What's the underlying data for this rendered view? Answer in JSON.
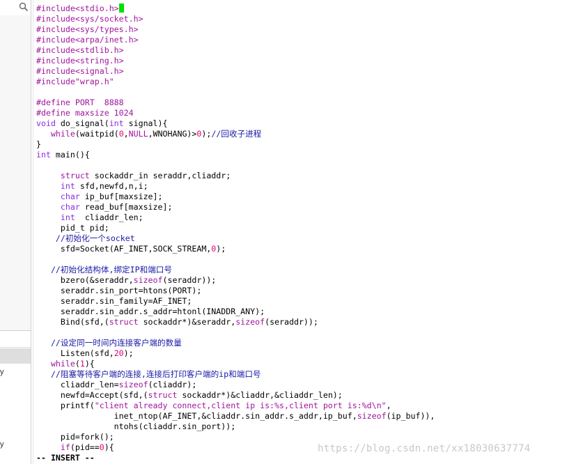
{
  "lower_panel": {
    "item_1_text": "y",
    "item_2_text": "y"
  },
  "code_lines": [
    "#include<stdio.h>",
    "#include<sys/socket.h>",
    "#include<sys/types.h>",
    "#include<arpa/inet.h>",
    "#include<stdlib.h>",
    "#include<string.h>",
    "#include<signal.h>",
    "#include\"wrap.h\"",
    "",
    "#define PORT  8888",
    "#define maxsize 1024",
    "void do_signal(int signal){",
    "   while(waitpid(0,NULL,WNOHANG)>0);//回收子进程",
    "}",
    "int main(){",
    "",
    "     struct sockaddr_in seraddr,cliaddr;",
    "     int sfd,newfd,n,i;",
    "     char ip_buf[maxsize];",
    "     char read_buf[maxsize];",
    "     int  cliaddr_len;",
    "     pid_t pid;",
    "    //初始化一个socket",
    "     sfd=Socket(AF_INET,SOCK_STREAM,0);",
    "",
    "   //初始化结构体,绑定IP和端口号",
    "     bzero(&seraddr,sizeof(seraddr));",
    "     seraddr.sin_port=htons(PORT);",
    "     seraddr.sin_family=AF_INET;",
    "     seraddr.sin_addr.s_addr=htonl(INADDR_ANY);",
    "     Bind(sfd,(struct sockaddr*)&seraddr,sizeof(seraddr));",
    "",
    "   //设定同一时间内连接客户端的数量",
    "     Listen(sfd,20);",
    "   while(1){",
    "   //阻塞等待客户端的连接,连接后打印客户端的ip和端口号",
    "     cliaddr_len=sizeof(cliaddr);",
    "     newfd=Accept(sfd,(struct sockaddr*)&cliaddr,&cliaddr_len);",
    "     printf(\"client already connect,client ip is:%s,client port is:%d\\n\",",
    "                inet_ntop(AF_INET,&cliaddr.sin_addr.s_addr,ip_buf,sizeof(ip_buf)),",
    "                ntohs(cliaddr.sin_port));",
    "     pid=fork();",
    "     if(pid==0){"
  ],
  "status": {
    "mode": "-- INSERT --"
  },
  "watermark": "https://blog.csdn.net/xx18030637774",
  "colors": {
    "preprocessor": "#a0149c",
    "keyword": "#a0149c",
    "type": "#8a2be2",
    "number": "#e0007a",
    "comment": "#1a1aa6",
    "cursor": "#00e000"
  },
  "icons": {
    "search": "search-icon"
  }
}
